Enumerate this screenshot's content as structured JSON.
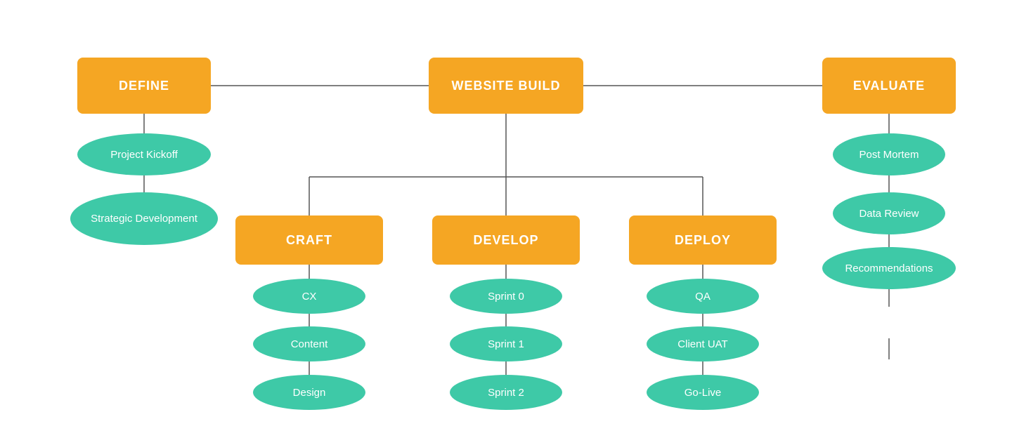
{
  "colors": {
    "orange": "#F5A623",
    "teal": "#3EC9A7",
    "line": "#777777"
  },
  "nodes": {
    "websiteBuild": {
      "label": "WEBSITE BUILD"
    },
    "define": {
      "label": "DEFINE"
    },
    "evaluate": {
      "label": "EVALUATE"
    },
    "craft": {
      "label": "CRAFT"
    },
    "develop": {
      "label": "DEVELOP"
    },
    "deploy": {
      "label": "DEPLOY"
    },
    "projectKickoff": {
      "label": "Project Kickoff"
    },
    "strategicDevelopment": {
      "label": "Strategic Development"
    },
    "cx": {
      "label": "CX"
    },
    "content": {
      "label": "Content"
    },
    "design": {
      "label": "Design"
    },
    "sprint0": {
      "label": "Sprint 0"
    },
    "sprint1": {
      "label": "Sprint 1"
    },
    "sprint2": {
      "label": "Sprint 2"
    },
    "qa": {
      "label": "QA"
    },
    "clientUAT": {
      "label": "Client UAT"
    },
    "goLive": {
      "label": "Go-Live"
    },
    "postMortem": {
      "label": "Post Mortem"
    },
    "dataReview": {
      "label": "Data Review"
    },
    "recommendations": {
      "label": "Recommendations"
    }
  }
}
